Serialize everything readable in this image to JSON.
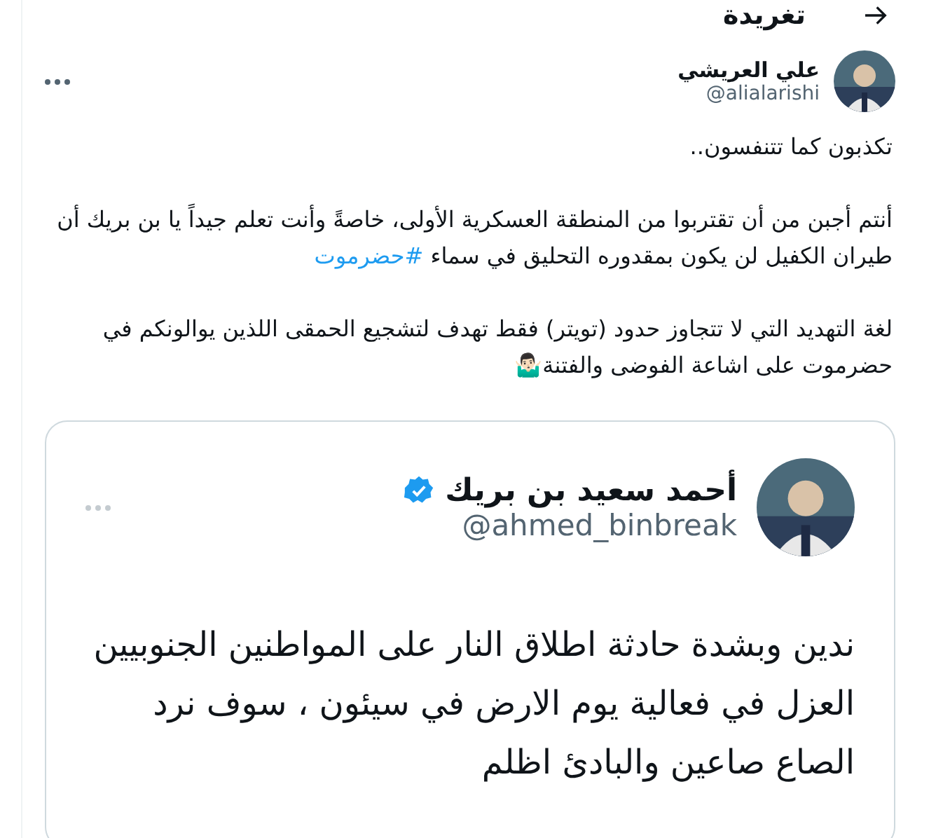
{
  "header": {
    "title": "تغريدة"
  },
  "author": {
    "name": "علي العريشي",
    "handle": "@alialarishi"
  },
  "tweet": {
    "paragraphs": [
      [
        {
          "kind": "text",
          "text": "تكذبون كما تتنفسون.."
        }
      ],
      [
        {
          "kind": "text",
          "text": "أنتم أجبن من أن تقتربوا من المنطقة العسكرية الأولى، خاصةً وأنت تعلم جيداً يا بن بريك أن طيران الكفيل لن يكون بمقدوره التحليق في سماء "
        },
        {
          "kind": "hashtag",
          "text": "#حضرموت"
        }
      ],
      [
        {
          "kind": "text",
          "text": "لغة التهديد التي لا تتجاوز حدود (تويتر) فقط تهدف لتشجيع الحمقى اللذين يوالونكم في حضرموت على اشاعة الفوضى والفتنة🤷🏻‍♂️"
        }
      ]
    ]
  },
  "attached_image": {
    "name": "أحمد سعيد بن بريك",
    "verified": true,
    "handle": "@ahmed_binbreak",
    "text": "ندين وبشدة حادثة اطلاق النار على المواطنين الجنوبيين العزل في فعالية يوم الارض في سيئون ، سوف نرد الصاع صاعين والبادئ اظلم"
  }
}
